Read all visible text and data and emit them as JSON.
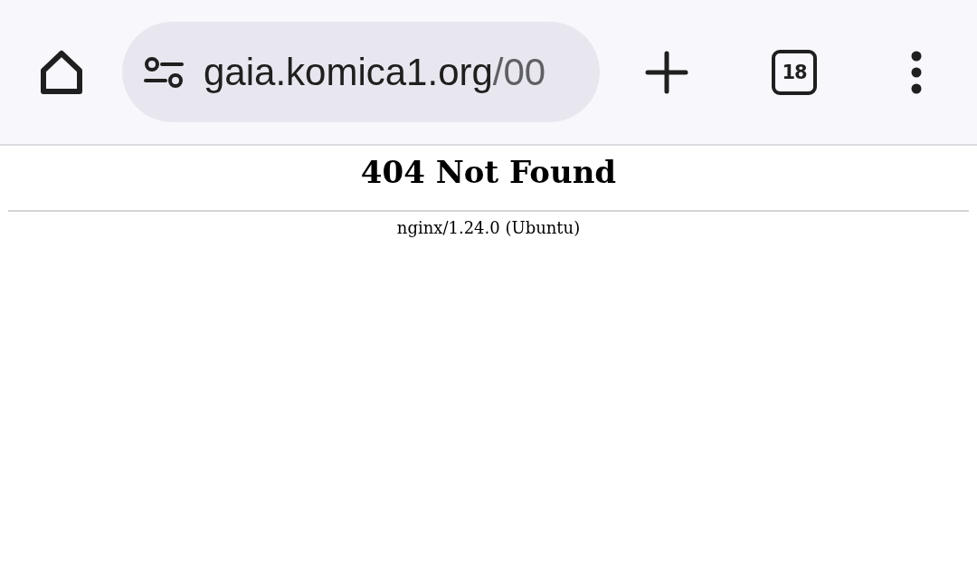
{
  "toolbar": {
    "url_host": "gaia.komica1.org",
    "url_path": "/00",
    "tab_count": "18"
  },
  "page": {
    "heading": "404 Not Found",
    "server": "nginx/1.24.0 (Ubuntu)"
  }
}
